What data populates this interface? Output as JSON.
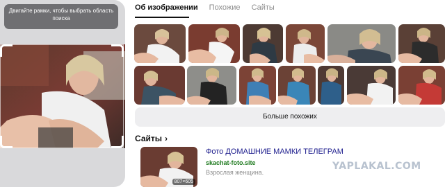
{
  "query": {
    "hint": "Двигайте рамки, чтобы выбрать область поиска"
  },
  "tabs": [
    {
      "label": "Об изображении",
      "active": true
    },
    {
      "label": "Похожие",
      "active": false
    },
    {
      "label": "Сайты",
      "active": false
    }
  ],
  "similar": {
    "more_label": "Больше похожих"
  },
  "sites": {
    "heading": "Сайты",
    "results": [
      {
        "title": "Фото ДОМАШНИЕ МАМКИ ТЕЛЕГРАМ",
        "url": "skachat-foto.site",
        "description": "Взрослая женщина.",
        "dimensions": "807×605"
      }
    ]
  },
  "watermark": "YAPLAKAL.COM",
  "colors": {
    "accent_link": "#1b1b8c",
    "url_green": "#1f7a1f",
    "panel_bg": "#d9d9db",
    "button_bg": "#eeeef0"
  }
}
